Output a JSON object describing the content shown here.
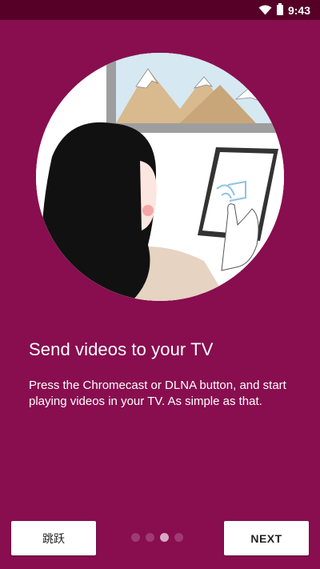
{
  "status_bar": {
    "time": "9:43",
    "icons": [
      "wifi-icon",
      "battery-icon"
    ]
  },
  "onboarding": {
    "illustration": "person-tablet-cast-illustration",
    "title": "Send videos to your TV",
    "description": "Press the Chromecast or DLNA button, and start playing videos in your TV. As simple as that.",
    "page_indicator": {
      "total": 4,
      "current": 3
    }
  },
  "buttons": {
    "skip_label": "跳跃",
    "next_label": "NEXT"
  },
  "colors": {
    "background": "#880e4f",
    "status_bar": "#560027",
    "dot_inactive": "#a03a72",
    "dot_active": "#d7a9c2"
  }
}
